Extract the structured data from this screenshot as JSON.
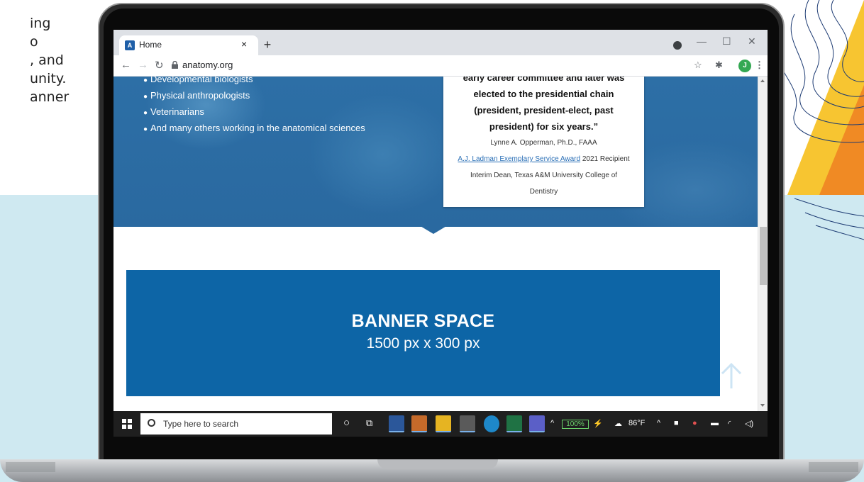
{
  "slide": {
    "text_lines": [
      "ing",
      "o",
      ", and",
      "unity.",
      "anner"
    ]
  },
  "browser": {
    "tab_title": "Home",
    "tab_close": "×",
    "new_tab": "+",
    "url": "anatomy.org",
    "window_controls": {
      "minimize": "—",
      "maximize": "☐",
      "close": "✕"
    },
    "profile_initial": "J"
  },
  "page": {
    "hero_list": [
      "Developmental biologists",
      "Physical anthropologists",
      "Veterinarians",
      "And many others working in the anatomical sciences"
    ],
    "quote": {
      "lines_bold": [
        "early career committee and later was",
        "elected to the presidential chain",
        "(president, president-elect, past",
        "president) for six years.”"
      ],
      "author": "Lynne A. Opperman, Ph.D., FAAA",
      "award_link": "A.J. Ladman Exemplary Service Award",
      "award_suffix": " 2021 Recipient",
      "title_line1": "Interim Dean, Texas A&M University College of",
      "title_line2": "Dentistry"
    },
    "banner": {
      "title": "BANNER SPACE",
      "subtitle": "1500 px x 300 px"
    }
  },
  "taskbar": {
    "search_placeholder": "Type here to search",
    "battery": "100%",
    "weather": "86°F"
  },
  "colors": {
    "hero_blue": "#2a69a0",
    "banner_blue": "#0d65a6",
    "link_blue": "#2a6fb6"
  }
}
